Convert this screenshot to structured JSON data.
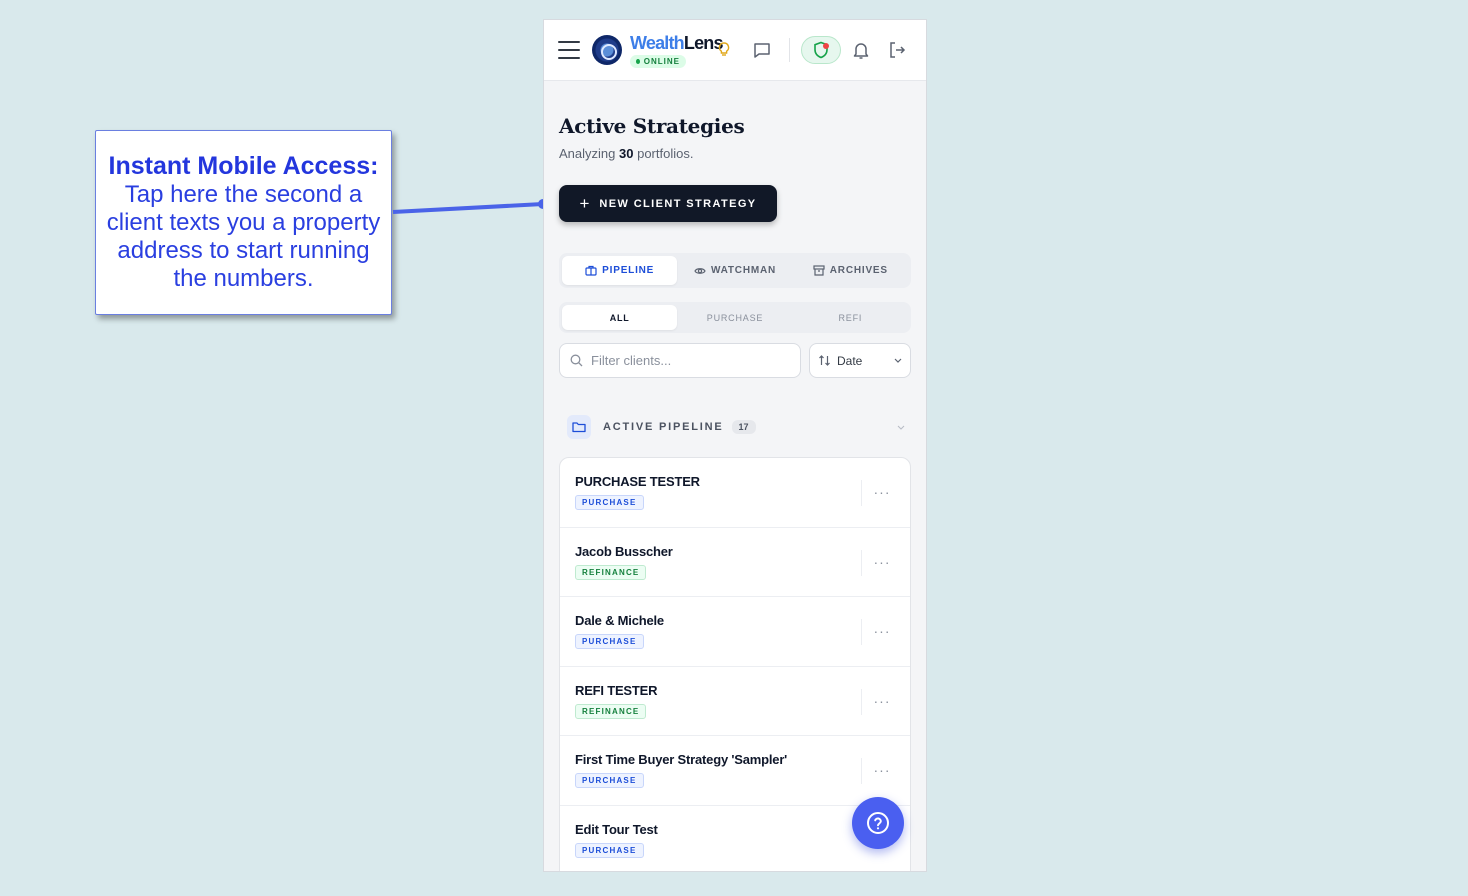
{
  "callout": {
    "title": "Instant Mobile Access:",
    "body": "Tap here the second a client texts you a property address to start running the numbers."
  },
  "header": {
    "brand_part1": "Wealth",
    "brand_part2": "Lens",
    "status": "ONLINE",
    "icons": [
      "menu-icon",
      "logo",
      "lightbulb-icon",
      "chat-icon",
      "shield-icon",
      "bell-icon",
      "logout-icon"
    ]
  },
  "page": {
    "title": "Active Strategies",
    "subtitle_prefix": "Analyzing",
    "portfolio_count": "30",
    "subtitle_suffix": "portfolios.",
    "new_button_label": "NEW CLIENT STRATEGY"
  },
  "tabs": [
    {
      "label": "PIPELINE",
      "icon": "briefcase-icon",
      "active": true
    },
    {
      "label": "WATCHMAN",
      "icon": "eye-icon",
      "active": false
    },
    {
      "label": "ARCHIVES",
      "icon": "archive-icon",
      "active": false
    }
  ],
  "filters": [
    {
      "label": "ALL",
      "active": true
    },
    {
      "label": "PURCHASE",
      "active": false
    },
    {
      "label": "REFI",
      "active": false
    }
  ],
  "search": {
    "placeholder": "Filter clients..."
  },
  "sort": {
    "label": "Date"
  },
  "group": {
    "title": "ACTIVE PIPELINE",
    "count": "17"
  },
  "clients": [
    {
      "name": "PURCHASE TESTER",
      "tag": "PURCHASE",
      "type": "purchase"
    },
    {
      "name": "Jacob Busscher",
      "tag": "REFINANCE",
      "type": "refinance"
    },
    {
      "name": "Dale & Michele",
      "tag": "PURCHASE",
      "type": "purchase"
    },
    {
      "name": "REFI TESTER",
      "tag": "REFINANCE",
      "type": "refinance"
    },
    {
      "name": "First Time Buyer Strategy 'Sampler'",
      "tag": "PURCHASE",
      "type": "purchase"
    },
    {
      "name": "Edit Tour Test",
      "tag": "PURCHASE",
      "type": "purchase"
    }
  ],
  "colors": {
    "background": "#d9e9ec",
    "callout_text": "#2336dd",
    "primary_button": "#111827",
    "accent_blue": "#1d4ed8",
    "online_green": "#16a34a",
    "help_fab": "#4a5ff0"
  }
}
